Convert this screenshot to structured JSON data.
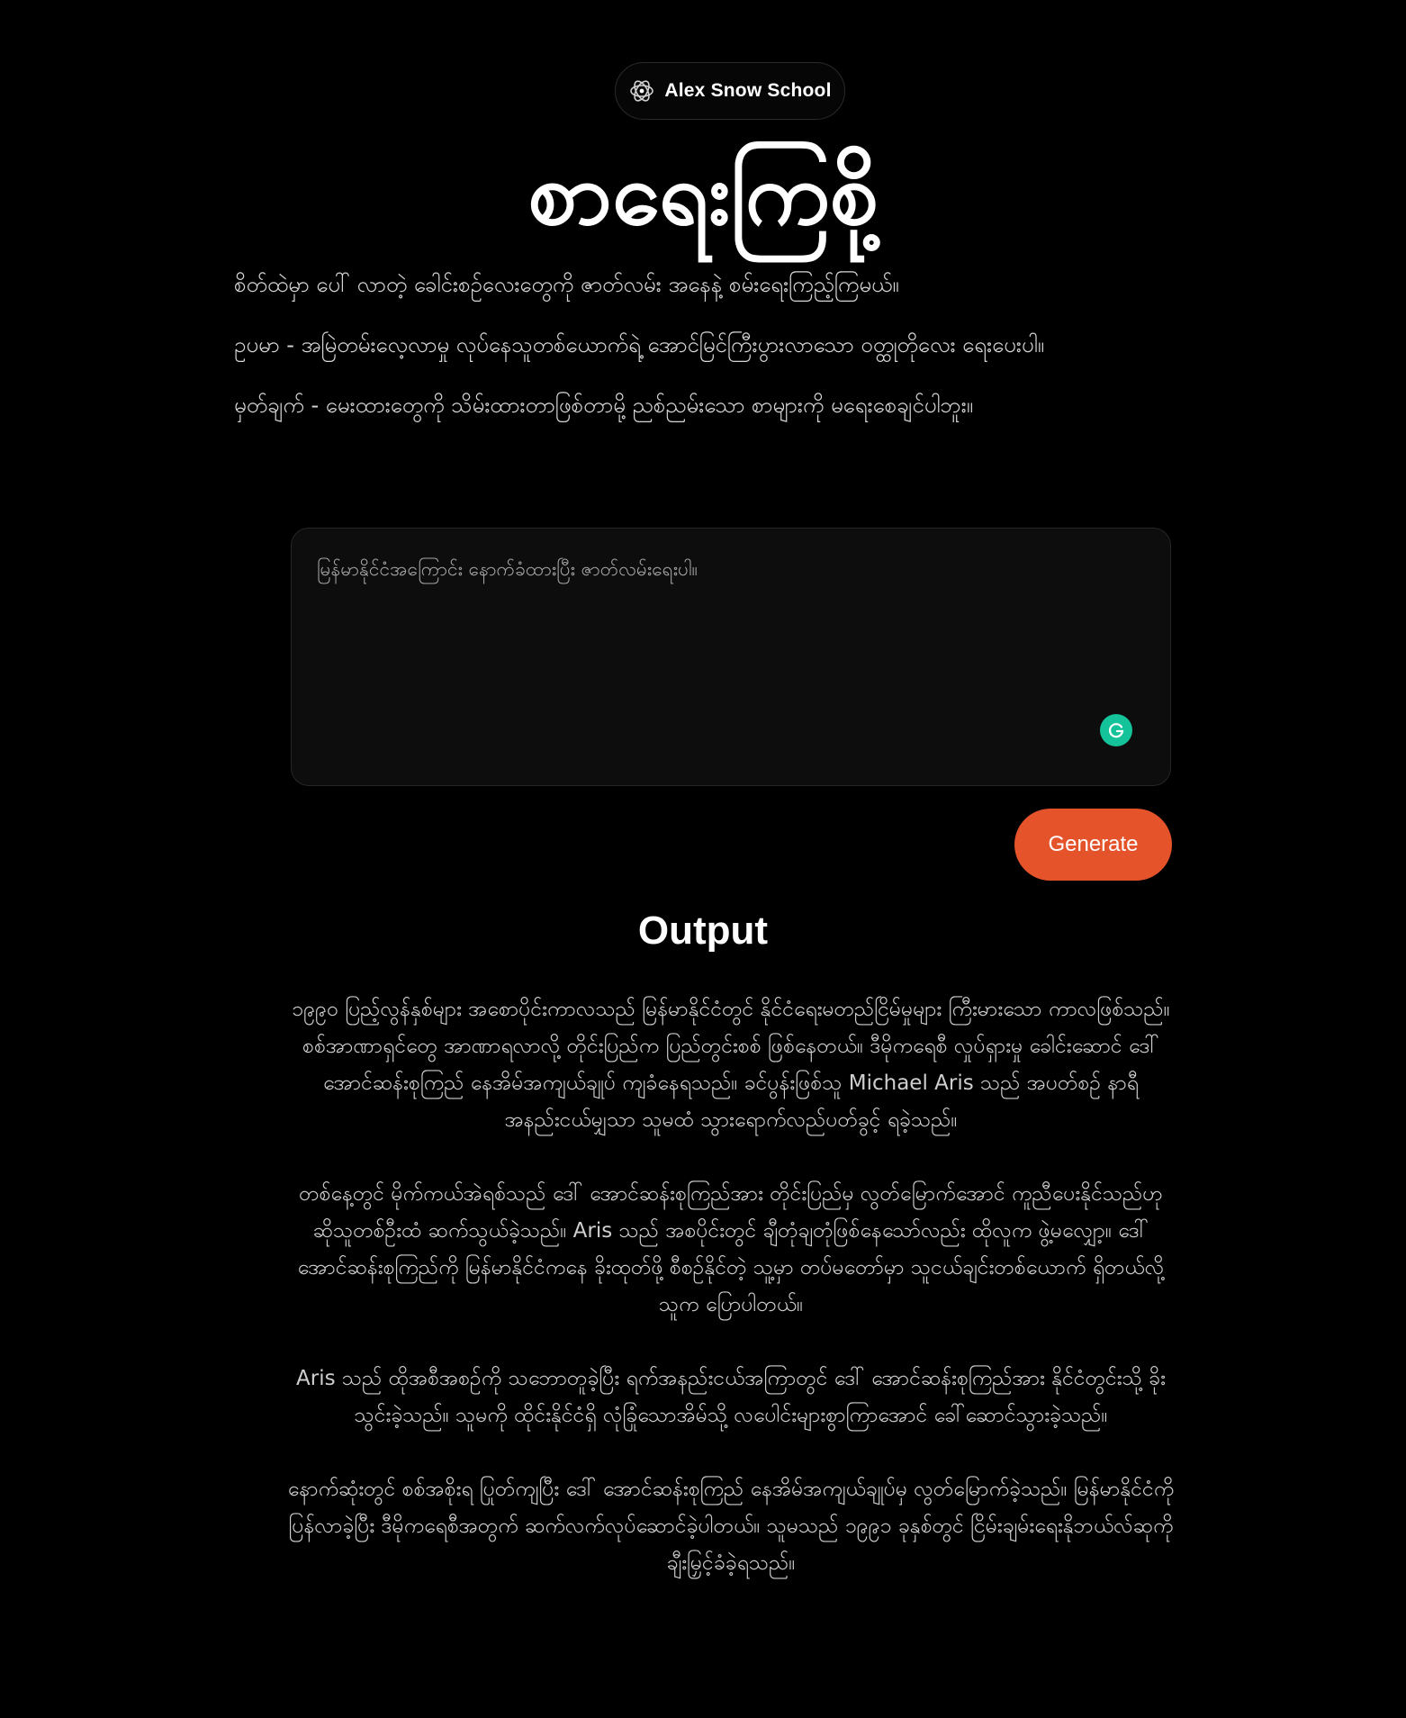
{
  "brand": {
    "name": "Alex Snow School",
    "icon": "logo-mark-icon"
  },
  "title": "စာရေးကြစို့",
  "intro": {
    "line1": "စိတ်ထဲမှာ ပေါ် လာတဲ့ ခေါင်းစဉ်လေးတွေကို ဇာတ်လမ်း အနေနဲ့ စမ်းရေးကြည့်ကြမယ်။",
    "line2": "ဥပမာ - အမြဲတမ်းလေ့လာမှု လုပ်နေသူတစ်ယောက်ရဲ့ အောင်မြင်ကြီးပွားလာသော ဝတ္ထုတိုလေး ရေးပေးပါ။",
    "line3": "မှတ်ချက် - မေးထားတွေကို သိမ်းထားတာဖြစ်တာမို့ ညစ်ညမ်းသော စာများကို မရေးစေချင်ပါဘူး။"
  },
  "prompt": {
    "placeholder": "မြန်မာနိုင်ငံအကြောင်း နောက်ခံထားပြီး ဇာတ်လမ်းရေးပါ။",
    "value": "",
    "assistant_icon": "grammarly-icon"
  },
  "generate_label": "Generate",
  "output": {
    "heading": "Output",
    "paragraphs": [
      "၁၉၉၀ ပြည့်လွန်နှစ်များ အစောပိုင်းကာလသည် မြန်မာနိုင်ငံတွင် နိုင်ငံရေးမတည်ငြိမ်မှုများ ကြီးမားသော ကာလဖြစ်သည်။ စစ်အာဏာရှင်တွေ အာဏာရလာလို့ တိုင်းပြည်က ပြည်တွင်းစစ် ဖြစ်နေတယ်။ ဒီမိုကရေစီ လှုပ်ရှားမှု ခေါင်းဆောင် ဒေါ် အောင်ဆန်းစုကြည် နေအိမ်အကျယ်ချုပ် ကျခံနေရသည်။ ခင်ပွန်းဖြစ်သူ Michael Aris သည် အပတ်စဉ် နာရီအနည်းငယ်မျှသာ သူမထံ သွားရောက်လည်ပတ်ခွင့် ရခဲ့သည်။",
      "တစ်နေ့တွင် မိုက်ကယ်အဲရစ်သည် ဒေါ် အောင်ဆန်းစုကြည်အား တိုင်းပြည်မှ လွတ်မြောက်အောင် ကူညီပေးနိုင်သည်ဟု ဆိုသူတစ်ဦးထံ ဆက်သွယ်ခဲ့သည်။ Aris သည် အစပိုင်းတွင် ချီတုံချတုံဖြစ်နေသော်လည်း ထိုလူက ဖွဲ့မလျှော့။ ဒေါ် အောင်ဆန်းစုကြည်ကို မြန်မာနိုင်ငံကနေ ခိုးထုတ်ဖို့ စီစဉ်နိုင်တဲ့ သူ့မှာ တပ်မတော်မှာ သူငယ်ချင်းတစ်ယောက် ရှိတယ်လို့ သူက ပြောပါတယ်။",
      "Aris သည် ထိုအစီအစဉ်ကို သဘောတူခဲ့ပြီး ရက်အနည်းငယ်အကြာတွင် ဒေါ် အောင်ဆန်းစုကြည်အား နိုင်ငံတွင်းသို့ ခိုးသွင်းခဲ့သည်။ သူမကို ထိုင်းနိုင်ငံရှိ လုံခြုံသောအိမ်သို့ လပေါင်းများစွာကြာအောင် ခေါ်ဆောင်သွားခဲ့သည်။",
      "နောက်ဆုံးတွင် စစ်အစိုးရ ပြုတ်ကျပြီး ဒေါ် အောင်ဆန်းစုကြည် နေအိမ်အကျယ်ချုပ်မှ လွတ်မြောက်ခဲ့သည်။ မြန်မာနိုင်ငံကို ပြန်လာခဲ့ပြီး ဒီမိုကရေစီအတွက် ဆက်လက်လုပ်ဆောင်ခဲ့ပါတယ်။ သူမသည် ၁၉၉၁ ခုနှစ်တွင် ငြိမ်းချမ်းရေးနိုဘယ်လ်ဆုကို ချီးမြှင့်ခံခဲ့ရသည်။"
    ]
  },
  "colors": {
    "background": "#000000",
    "accent": "#e5532a",
    "assistant_green": "#15c39a"
  }
}
